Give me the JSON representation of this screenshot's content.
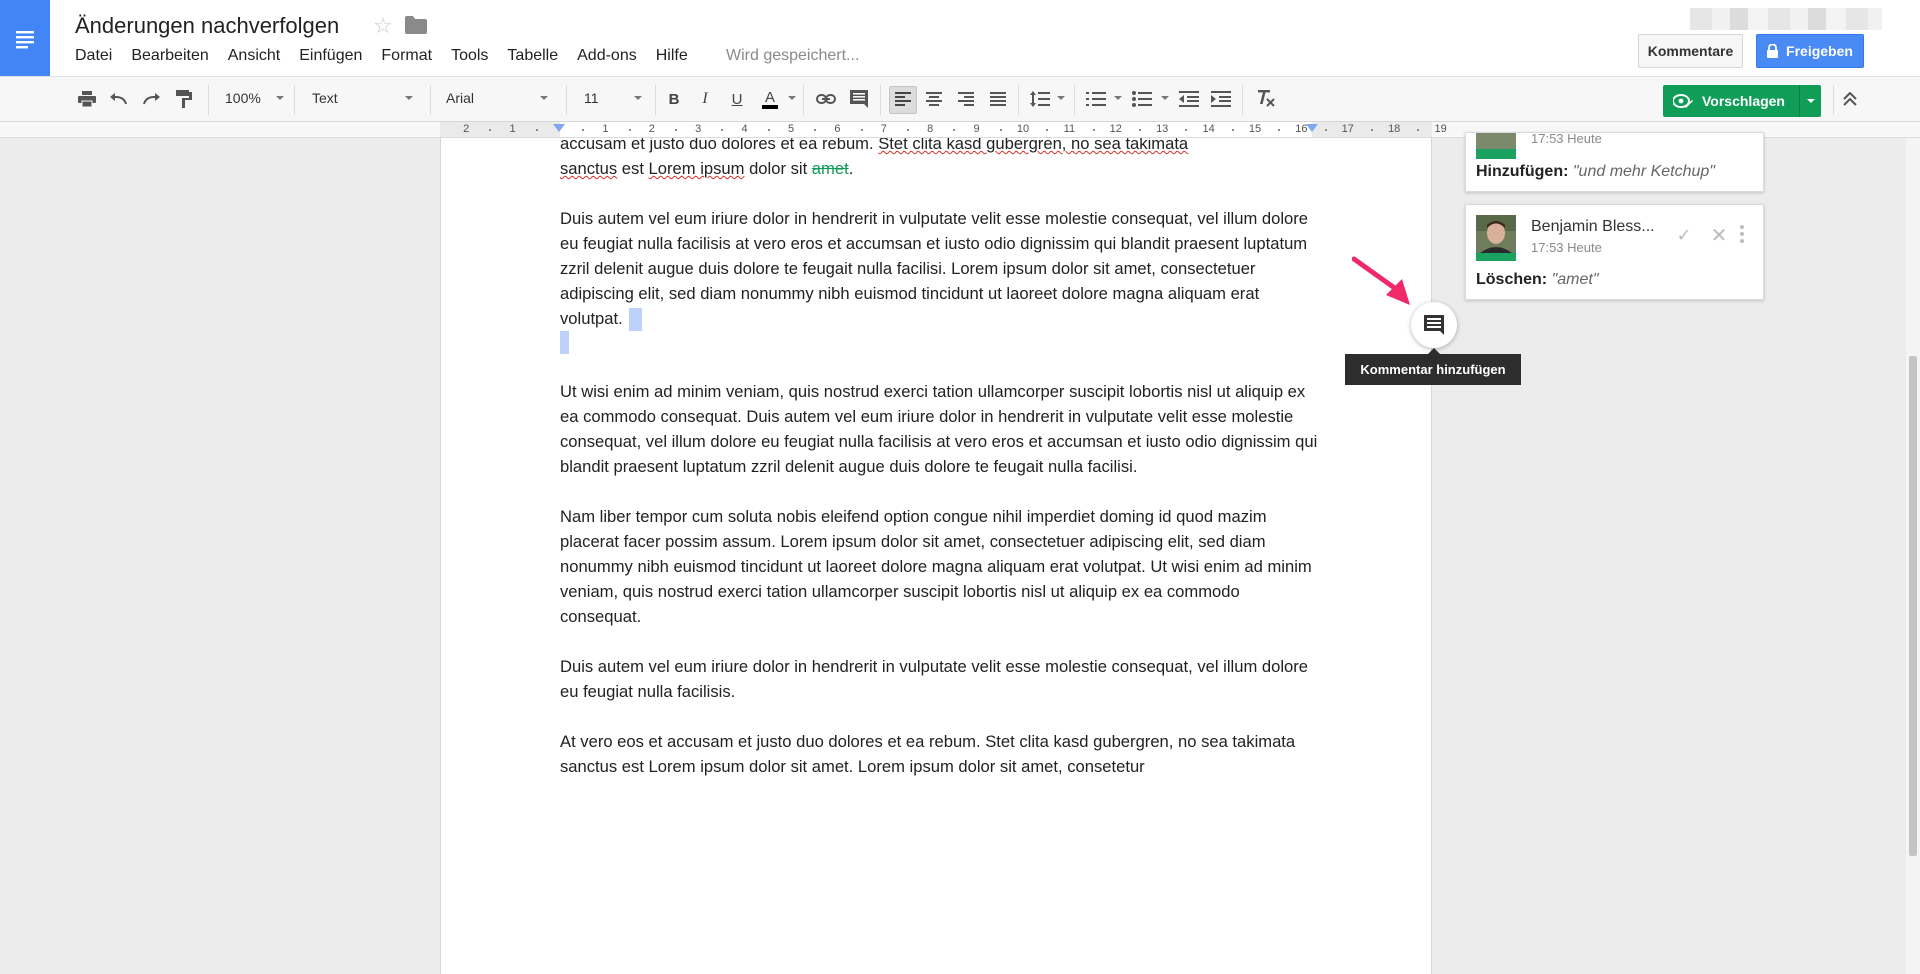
{
  "header": {
    "title": "Änderungen nachverfolgen",
    "menu": [
      "Datei",
      "Bearbeiten",
      "Ansicht",
      "Einfügen",
      "Format",
      "Tools",
      "Tabelle",
      "Add-ons",
      "Hilfe"
    ],
    "save_status": "Wird gespeichert...",
    "comments_label": "Kommentare",
    "share_label": "Freigeben"
  },
  "toolbar": {
    "zoom": "100%",
    "style": "Text",
    "font": "Arial",
    "font_size": "11",
    "suggest_label": "Vorschlagen",
    "bold_label": "B",
    "italic_label": "I",
    "underline_label": "U",
    "text_color_label": "A",
    "accent_color": "#0f9d58"
  },
  "ruler": {
    "left_numbers": [
      "2",
      "1"
    ],
    "right_numbers": [
      "1",
      "2",
      "3",
      "4",
      "5",
      "6",
      "7",
      "8",
      "9",
      "10",
      "11",
      "12",
      "13",
      "14",
      "15",
      "16",
      "17",
      "18",
      "19"
    ]
  },
  "document": {
    "p0_a": "accusam et justo duo dolores et ea rebum. ",
    "p0_b": "Stet clita kasd gubergren, no sea takimata",
    "p0_c": "sanctus",
    "p0_d": " est ",
    "p0_e": "Lorem ipsum",
    "p0_f": " dolor sit ",
    "p0_del": "amet",
    "p0_g": ".",
    "p1": "Duis autem vel eum iriure dolor in hendrerit in vulputate velit esse molestie consequat, vel illum dolore eu feugiat nulla facilisis at vero eros et accumsan et iusto odio dignissim qui blandit praesent luptatum zzril delenit augue duis dolore te feugait nulla facilisi. Lorem ipsum dolor sit amet, consectetuer adipiscing elit, sed diam nonummy nibh euismod tincidunt ut laoreet dolore magna aliquam erat volutpat.",
    "p2": "Ut wisi enim ad minim veniam, quis nostrud exerci tation ullamcorper suscipit lobortis nisl ut aliquip ex ea commodo consequat. Duis autem vel eum iriure dolor in hendrerit in vulputate velit esse molestie consequat, vel illum dolore eu feugiat nulla facilisis at vero eros et accumsan et iusto odio dignissim qui blandit praesent luptatum zzril delenit augue duis dolore te feugait nulla facilisi.",
    "p3": "Nam liber tempor cum soluta nobis eleifend option congue nihil imperdiet doming id quod mazim placerat facer possim assum. Lorem ipsum dolor sit amet, consectetuer adipiscing elit, sed diam nonummy nibh euismod tincidunt ut laoreet dolore magna aliquam erat volutpat. Ut wisi enim ad minim veniam, quis nostrud exerci tation ullamcorper suscipit lobortis nisl ut aliquip ex ea commodo consequat.",
    "p4": "Duis autem vel eum iriure dolor in hendrerit in vulputate velit esse molestie consequat, vel illum dolore eu feugiat nulla facilisis.",
    "p5": "At vero eos et accusam et justo duo dolores et ea rebum. Stet clita kasd gubergren, no sea takimata sanctus est Lorem ipsum dolor sit amet. Lorem ipsum dolor sit amet, consetetur"
  },
  "suggestions": [
    {
      "time": "17:53 Heute",
      "action": "Hinzufügen:",
      "text": "\"und mehr Ketchup\""
    },
    {
      "name": "Benjamin Bless...",
      "time": "17:53 Heute",
      "action": "Löschen:",
      "text": "\"amet\""
    }
  ],
  "add_comment_tooltip": "Kommentar hinzufügen"
}
